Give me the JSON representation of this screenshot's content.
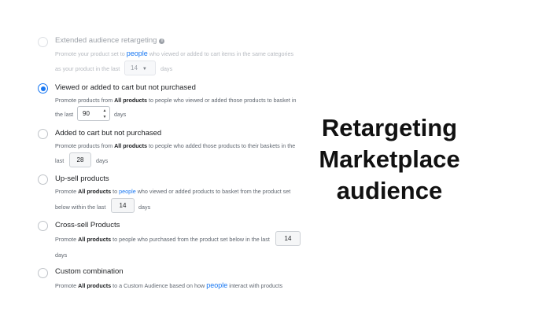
{
  "options": [
    {
      "title": "Extended audience retargeting",
      "desc1_pre": "Promote your product set to ",
      "desc1_link": "people",
      "desc1_post": " who viewed or added to cart items in the same categories",
      "desc2_pre": "as your product in the last",
      "value": "14",
      "unit": "days"
    },
    {
      "title": "Viewed or added to cart but not purchased",
      "desc1_pre": "Promote products from ",
      "desc1_bold": "All products",
      "desc1_post": " to people who viewed or added those products to basket in",
      "desc2_pre": "the last",
      "value": "90",
      "unit": "days"
    },
    {
      "title": "Added to cart but not purchased",
      "desc1_pre": "Promote products from ",
      "desc1_bold": "All products",
      "desc1_post": " to people who added those products to their baskets in the",
      "desc2_pre": "last",
      "value": "28",
      "unit": "days"
    },
    {
      "title": "Up-sell products",
      "desc1_pre": "Promote ",
      "desc1_bold": "All products",
      "desc1_mid": " to ",
      "desc1_link": "people",
      "desc1_post": " who viewed or added products to basket from the product set",
      "desc2_pre": "below within the last",
      "value": "14",
      "unit": "days"
    },
    {
      "title": "Cross-sell Products",
      "desc1_pre": "Promote ",
      "desc1_bold": "All products",
      "desc1_post": " to people who purchased from the product set below in the last",
      "value": "14",
      "unit": "days"
    },
    {
      "title": "Custom combination",
      "desc1_pre": "Promote ",
      "desc1_bold": "All products",
      "desc1_mid": " to a Custom Audience based on how ",
      "desc1_link": "people",
      "desc1_post": " interact with products"
    }
  ],
  "headline": {
    "line1": "Retargeting",
    "line2": "Marketplace",
    "line3": "audience"
  },
  "colors": {
    "accent": "#1877f2",
    "text": "#1c1e21",
    "secondary": "#606770"
  },
  "icons": {
    "info": "info-icon",
    "dropdown": "chevron-down-icon",
    "stepper": "stepper-arrows-icon"
  }
}
